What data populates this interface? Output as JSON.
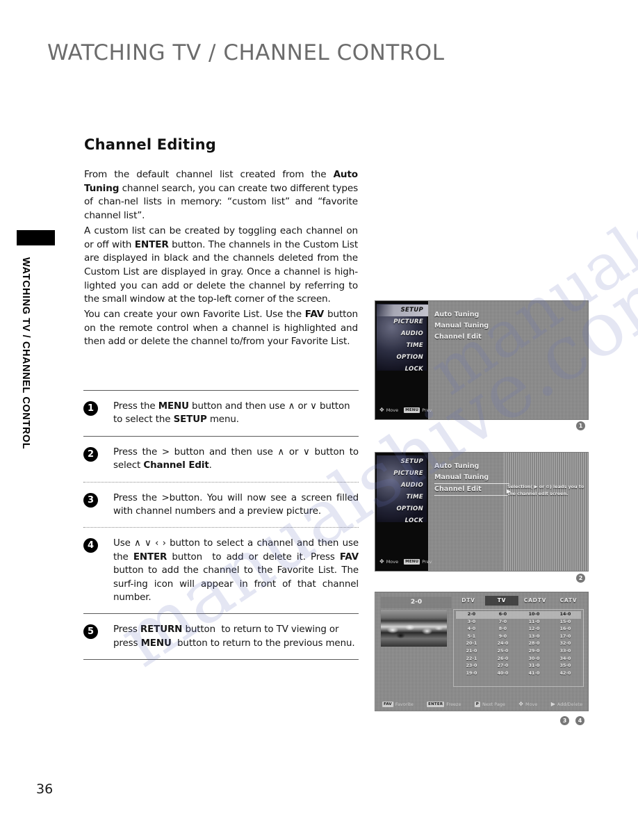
{
  "page": {
    "title": "WATCHING TV / CHANNEL CONTROL",
    "side_tab_label": "WATCHING TV / CHANNEL CONTROL",
    "number": "36",
    "watermark": "manualshive.com"
  },
  "section": {
    "heading": "Channel Editing",
    "paragraphs": [
      "From the default channel list created from the Auto Tuning channel search, you can create two different types of channel lists in memory: “custom list” and “favorite channel list”.",
      "A custom list can be created by toggling each channel on or off with ENTER button. The channels in the Custom List are displayed in black and the channels deleted from the Custom List are displayed in gray. Once a channel is highlighted you can add or delete the channel by referring to the small window at the top-left corner of the screen.",
      "You can create your own Favorite List. Use the FAV button on the remote control when a channel is highlighted and then add or delete the channel to/from your Favorite List."
    ]
  },
  "steps": [
    {
      "number": "1",
      "badge": "❶",
      "text": "Press the MENU button and then use ∧ or ∨ button to select the SETUP menu."
    },
    {
      "number": "2",
      "badge": "❷",
      "text": "Press the > button and then use ∧ or ∨ button to select Channel Edit."
    },
    {
      "number": "3",
      "badge": "❸",
      "text": "Press the > button. You will now see a screen filled with channel numbers and a preview picture."
    },
    {
      "number": "4",
      "badge": "❹",
      "text": "Use ∧ ∨ ‹ › button to select a channel and then use the ENTER button  to add or delete it. Press FAV button to add the channel to the Favorite List. The surfing icon will appear in front of that channel number."
    },
    {
      "number": "5",
      "badge": "❺",
      "text": "Press RETURN button  to return to TV viewing or press MENU  button to return to the previous menu."
    }
  ],
  "screenshots": {
    "shot1": {
      "menu": [
        {
          "label": "SETUP",
          "selected": true
        },
        {
          "label": "PICTURE",
          "selected": false
        },
        {
          "label": "AUDIO",
          "selected": false
        },
        {
          "label": "TIME",
          "selected": false
        },
        {
          "label": "OPTION",
          "selected": false
        },
        {
          "label": "LOCK",
          "selected": false
        }
      ],
      "items": [
        {
          "label": "Auto Tuning"
        },
        {
          "label": "Manual Tuning"
        },
        {
          "label": "Channel Edit"
        }
      ],
      "footer": [
        {
          "key": "✥",
          "label": "Move"
        },
        {
          "key": "MENU",
          "label": "Prev"
        }
      ],
      "badges": [
        "❶"
      ]
    },
    "shot2": {
      "menu": [
        {
          "label": "SETUP",
          "selected": false
        },
        {
          "label": "PICTURE",
          "selected": false
        },
        {
          "label": "AUDIO",
          "selected": false
        },
        {
          "label": "TIME",
          "selected": false
        },
        {
          "label": "OPTION",
          "selected": false
        },
        {
          "label": "LOCK",
          "selected": false
        }
      ],
      "items": [
        {
          "label": "Auto Tuning"
        },
        {
          "label": "Manual Tuning"
        },
        {
          "label": "Channel Edit"
        }
      ],
      "selected_item_arrow": "▶",
      "help_text": "Selection( ▶ or ⊙) leads you to the channel edit screen.",
      "footer": [
        {
          "key": "✥",
          "label": "Move"
        },
        {
          "key": "MENU",
          "label": "Prev"
        }
      ],
      "badges": [
        "❷"
      ]
    },
    "shot3": {
      "preview_channel": "2-0",
      "tabs": [
        {
          "label": "DTV",
          "selected": false
        },
        {
          "label": "TV",
          "selected": true
        },
        {
          "label": "CADTV",
          "selected": false
        },
        {
          "label": "CATV",
          "selected": false
        }
      ],
      "grid_rows": [
        [
          "2-0",
          "6-0",
          "10-0",
          "14-0"
        ],
        [
          "3-0",
          "7-0",
          "11-0",
          "15-0"
        ],
        [
          "4-0",
          "8-0",
          "12-0",
          "16-0"
        ],
        [
          "5-1",
          "9-0",
          "13-0",
          "17-0"
        ],
        [
          "20-1",
          "24-0",
          "28-0",
          "32-0"
        ],
        [
          "21-0",
          "25-0",
          "29-0",
          "33-0"
        ],
        [
          "22-1",
          "26-0",
          "30-0",
          "34-0"
        ],
        [
          "23-0",
          "27-0",
          "31-0",
          "35-0"
        ],
        [
          "19-0",
          "40-0",
          "41-0",
          "42-0"
        ]
      ],
      "footer": [
        {
          "key": "FAV",
          "label": "Favorite"
        },
        {
          "key": "ENTER",
          "label": "Freeze"
        },
        {
          "key": "P",
          "label": "Next Page"
        },
        {
          "key": "✥",
          "label": "Move"
        },
        {
          "key": "▶",
          "label": "Add/Delete"
        }
      ],
      "badges": [
        "❸",
        "❹"
      ]
    }
  }
}
